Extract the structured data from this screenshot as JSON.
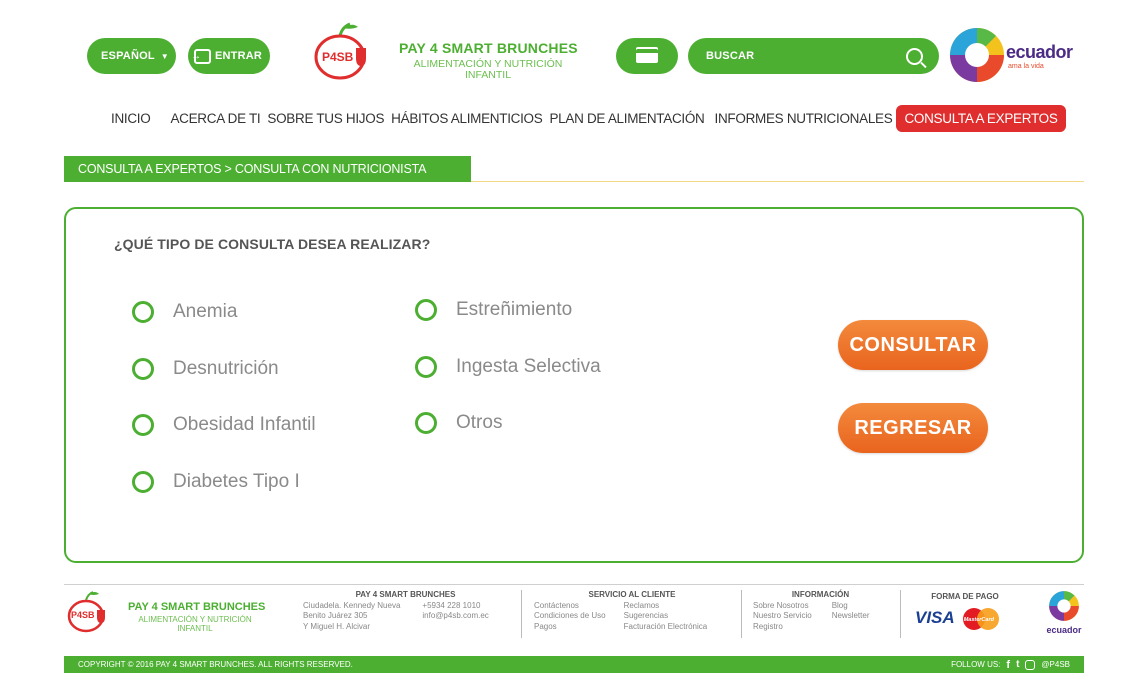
{
  "header": {
    "language": "ESPAÑOL",
    "login": "ENTRAR",
    "brand_title": "PAY 4 SMART BRUNCHES",
    "brand_sub1": "ALIMENTACIÓN Y NUTRICIÓN",
    "brand_sub2": "INFANTIL",
    "logo_text": "P4SB",
    "search_placeholder": "BUSCAR",
    "ecuador_text": "ecuador",
    "ecuador_sub": "ama la vida"
  },
  "nav": [
    "INICIO",
    "ACERCA DE TI",
    "SOBRE TUS HIJOS",
    "HÁBITOS ALIMENTICIOS",
    "PLAN DE ALIMENTACIÓN",
    "INFORMES NUTRICIONALES",
    "CONSULTA A EXPERTOS"
  ],
  "breadcrumb": "CONSULTA A EXPERTOS > CONSULTA CON NUTRICIONISTA",
  "question": "¿QUÉ TIPO DE CONSULTA DESEA REALIZAR?",
  "options_left": [
    "Anemia",
    "Desnutrición",
    "Obesidad Infantil",
    "Diabetes Tipo I"
  ],
  "options_right": [
    "Estreñimiento",
    "Ingesta Selectiva",
    "Otros"
  ],
  "buttons": {
    "consult": "CONSULTAR",
    "back": "REGRESAR"
  },
  "footer": {
    "brand_title": "PAY 4 SMART BRUNCHES",
    "brand_sub1": "ALIMENTACIÓN Y NUTRICIÓN",
    "brand_sub2": "INFANTIL",
    "contact_head": "PAY 4 SMART BRUNCHES",
    "address": [
      "Ciudadela. Kennedy Nueva",
      "Benito Juárez 305",
      "Y Miguel H. Alcivar"
    ],
    "phone": "+5934 228 1010",
    "email": "info@p4sb.com.ec",
    "service_head": "SERVICIO AL CLIENTE",
    "service_col1": [
      "Contáctenos",
      "Condiciones de Uso",
      "Pagos"
    ],
    "service_col2": [
      "Reclamos",
      "Sugerencias",
      "Facturación Electrónica"
    ],
    "info_head": "INFORMACIÓN",
    "info_col1": [
      "Sobre Nosotros",
      "Nuestro Servicio",
      "Registro"
    ],
    "info_col2": [
      "Blog",
      "Newsletter"
    ],
    "pay_head": "FORMA DE PAGO",
    "visa": "VISA",
    "mastercard": "MasterCard",
    "copyright": "COPYRIGHT © 2016 PAY 4 SMART BRUNCHES. ALL RIGHTS RESERVED.",
    "follow": "FOLLOW US:",
    "handle": "@P4SB"
  },
  "colors": {
    "green": "#4caf32",
    "red": "#e02d2d",
    "orange": "#ef7a2e"
  }
}
